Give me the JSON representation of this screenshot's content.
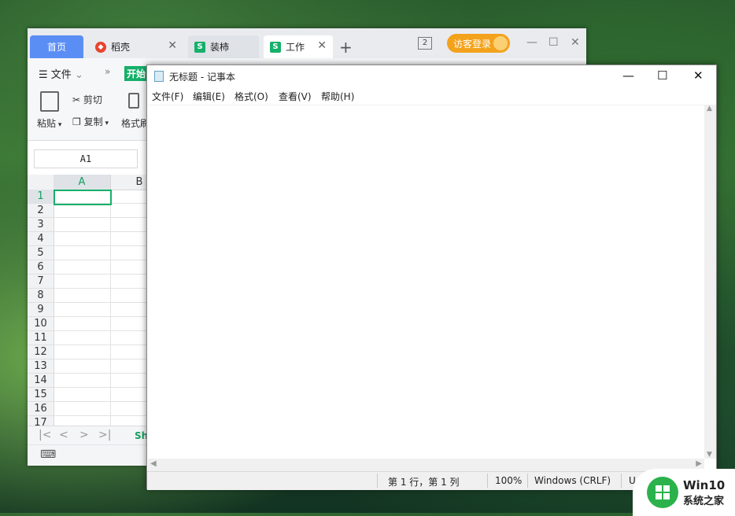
{
  "wps": {
    "tabs": [
      {
        "label": "首页"
      },
      {
        "label": "稻壳"
      },
      {
        "label": "装柿"
      },
      {
        "label": "工作"
      }
    ],
    "tab_count": "2",
    "login_label": "访客登录",
    "menu": {
      "file": "文件",
      "more": "»",
      "start": "开始"
    },
    "ribbon": {
      "paste": "粘贴",
      "cut": "剪切",
      "copy": "复制",
      "format_painter": "格式刷"
    },
    "name_box": "A1",
    "columns": [
      "A",
      "B"
    ],
    "rows": [
      "1",
      "2",
      "3",
      "4",
      "5",
      "6",
      "7",
      "8",
      "9",
      "10",
      "11",
      "12",
      "13",
      "14",
      "15",
      "16",
      "17"
    ],
    "sheet_tab": "Sh"
  },
  "notepad": {
    "title": "无标题 - 记事本",
    "menu": [
      "文件(F)",
      "编辑(E)",
      "格式(O)",
      "查看(V)",
      "帮助(H)"
    ],
    "status": {
      "position": "第 1 行，第 1 列",
      "zoom": "100%",
      "line_ending": "Windows (CRLF)",
      "encoding": "U"
    }
  },
  "watermark": {
    "line1": "Win10",
    "line2": "系统之家"
  },
  "colors": {
    "wps_green": "#15b06a",
    "home_tab_blue": "#5b8ef5",
    "login_orange": "#f3a21c"
  }
}
